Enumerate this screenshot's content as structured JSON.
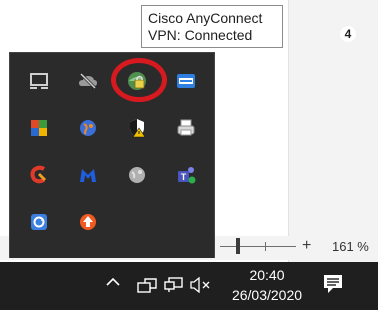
{
  "tooltip": {
    "line1": "Cisco AnyConnect",
    "line2": "VPN: Connected"
  },
  "status_bar": {
    "zoom_level": "161 %",
    "zoom_plus": "+"
  },
  "tray_icons": [
    "display-icon",
    "cloud-offline-icon",
    "cisco-anyconnect-vpn-icon",
    "ccs-app-icon",
    "office-suite-icon",
    "network-globe-icon",
    "security-shield-warning-icon",
    "printer-icon",
    "ccleaner-icon",
    "malwarebytes-icon",
    "gray-globe-icon",
    "teams-icon",
    "sync-app-icon",
    "update-arrow-icon"
  ],
  "taskbar": {
    "overflow_chevron": "^",
    "time": "20:40",
    "date": "26/03/2020",
    "notification_count": "4"
  },
  "colors": {
    "taskbar": "#1f1f1f",
    "flyout": "#2b2b2b",
    "highlight": "#d71920"
  }
}
